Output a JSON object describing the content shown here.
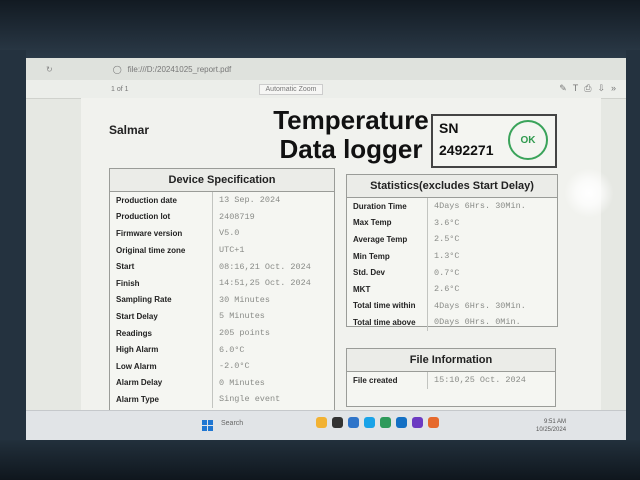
{
  "browser": {
    "url": "file:///D:/20241025_report.pdf",
    "page_indicator": "1  of 1",
    "zoom": "Automatic Zoom"
  },
  "header": {
    "company": "Salmar",
    "title_line1": "Temperature",
    "title_line2": "Data logger",
    "sn_label": "SN",
    "sn_value": "2492271",
    "status": "OK"
  },
  "device_spec": {
    "title": "Device Specification",
    "rows": [
      {
        "label": "Production date",
        "value": "13 Sep. 2024"
      },
      {
        "label": "Production lot",
        "value": "2408719"
      },
      {
        "label": "Firmware version",
        "value": "V5.0"
      },
      {
        "label": "Original time zone",
        "value": "UTC+1"
      },
      {
        "label": "Start",
        "value": "08:16,21 Oct. 2024"
      },
      {
        "label": "Finish",
        "value": "14:51,25 Oct. 2024"
      },
      {
        "label": "Sampling Rate",
        "value": "30 Minutes"
      },
      {
        "label": "Start Delay",
        "value": "5 Minutes"
      },
      {
        "label": "Readings",
        "value": "205 points"
      },
      {
        "label": "High Alarm",
        "value": "6.0°C"
      },
      {
        "label": "Low Alarm",
        "value": "-2.0°C"
      },
      {
        "label": "Alarm Delay",
        "value": "0 Minutes"
      },
      {
        "label": "Alarm Type",
        "value": "Single event"
      }
    ]
  },
  "statistics": {
    "title": "Statistics(excludes Start Delay)",
    "rows": [
      {
        "label": "Duration Time",
        "value": "4Days 6Hrs. 30Min."
      },
      {
        "label": "Max Temp",
        "value": "3.6°C"
      },
      {
        "label": "Average Temp",
        "value": "2.5°C"
      },
      {
        "label": "Min Temp",
        "value": "1.3°C"
      },
      {
        "label": "Std. Dev",
        "value": "0.7°C"
      },
      {
        "label": "MKT",
        "value": "2.6°C"
      },
      {
        "label": "Total time within",
        "value": "4Days 6Hrs. 30Min."
      },
      {
        "label": "Total time above",
        "value": "0Days 0Hrs. 0Min."
      }
    ]
  },
  "file_info": {
    "title": "File Information",
    "rows": [
      {
        "label": "File created",
        "value": "15:10,25 Oct. 2024"
      }
    ]
  },
  "taskbar": {
    "search": "Search",
    "time": "9:51 AM",
    "date": "10/25/2024"
  }
}
